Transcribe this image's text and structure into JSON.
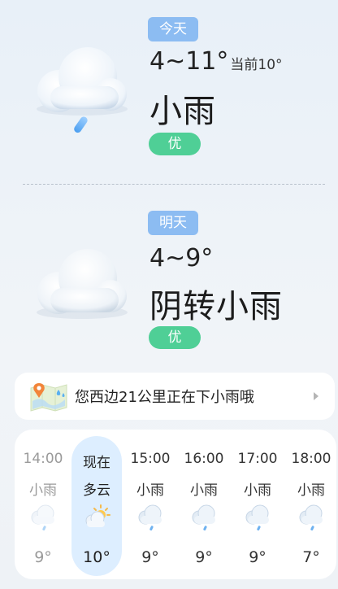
{
  "today": {
    "tag": "今天",
    "temp_range": "4~11°",
    "current": "当前10°",
    "condition": "小雨",
    "aqi": "优",
    "icon": "cloud-rain-icon"
  },
  "tomorrow": {
    "tag": "明天",
    "temp_range": "4~9°",
    "condition": "阴转小雨",
    "aqi": "优",
    "icon": "cloud-icon"
  },
  "alert": {
    "text": "您西边21公里正在下小雨哦",
    "icon": "map-pin-rain-icon"
  },
  "hourly": [
    {
      "time": "14:00",
      "condition": "小雨",
      "temp": "9°",
      "icon": "light-rain-icon"
    },
    {
      "time": "现在",
      "condition": "多云",
      "temp": "10°",
      "icon": "partly-cloudy-icon"
    },
    {
      "time": "15:00",
      "condition": "小雨",
      "temp": "9°",
      "icon": "light-rain-icon"
    },
    {
      "time": "16:00",
      "condition": "小雨",
      "temp": "9°",
      "icon": "light-rain-icon"
    },
    {
      "time": "17:00",
      "condition": "小雨",
      "temp": "9°",
      "icon": "light-rain-icon"
    },
    {
      "time": "18:00",
      "condition": "小雨",
      "temp": "7°",
      "icon": "light-rain-icon"
    }
  ],
  "colors": {
    "tag_blue": "#8cbcf2",
    "aqi_green": "#4fcf96",
    "now_highlight": "#ddeeff"
  }
}
